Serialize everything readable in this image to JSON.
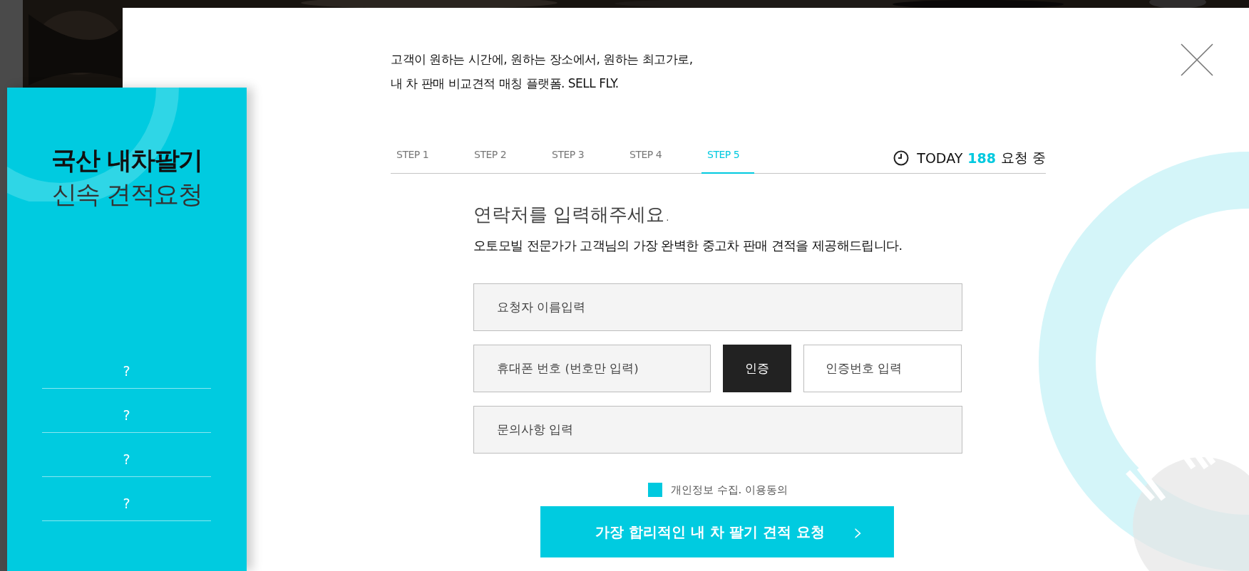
{
  "side_panel": {
    "title": "국산 내차팔기",
    "subtitle": "신속 견적요청",
    "items": [
      {
        "label": "?"
      },
      {
        "label": "?"
      },
      {
        "label": "?"
      },
      {
        "label": "?"
      }
    ]
  },
  "intro": [
    "고객이 원하는 시간에, 원하는 장소에서, 원하는 최고가로,",
    "내 차 판매 비교견적 매칭 플랫폼. SELL FLY."
  ],
  "steps": [
    {
      "label": "STEP 1",
      "selected": false
    },
    {
      "label": "STEP 2",
      "selected": false
    },
    {
      "label": "STEP 3",
      "selected": false
    },
    {
      "label": "STEP 4",
      "selected": false
    },
    {
      "label": "STEP 5",
      "selected": true
    }
  ],
  "today": {
    "label": "TODAY",
    "count": "188",
    "suffix": "요청 중"
  },
  "heading": "연락처를 입력해주세요.",
  "subheading": "오토모빌 전문가가 고객님의 가장 완벽한 중고차 판매 견적을 제공해드립니다.",
  "form": {
    "name": {
      "placeholder": "요청자 이름입력"
    },
    "phone": {
      "placeholder": "휴대폰 번호 (번호만 입력)"
    },
    "verify_button": "인증",
    "code": {
      "placeholder": "인증번호 입력"
    },
    "inquiry": {
      "placeholder": "문의사항 입력"
    }
  },
  "consent": {
    "label": "개인정보 수집. 이용동의",
    "checked": true
  },
  "submit": {
    "label": "가장 합리적인 내 차 팔기 견적 요청",
    "arrow": "›"
  }
}
